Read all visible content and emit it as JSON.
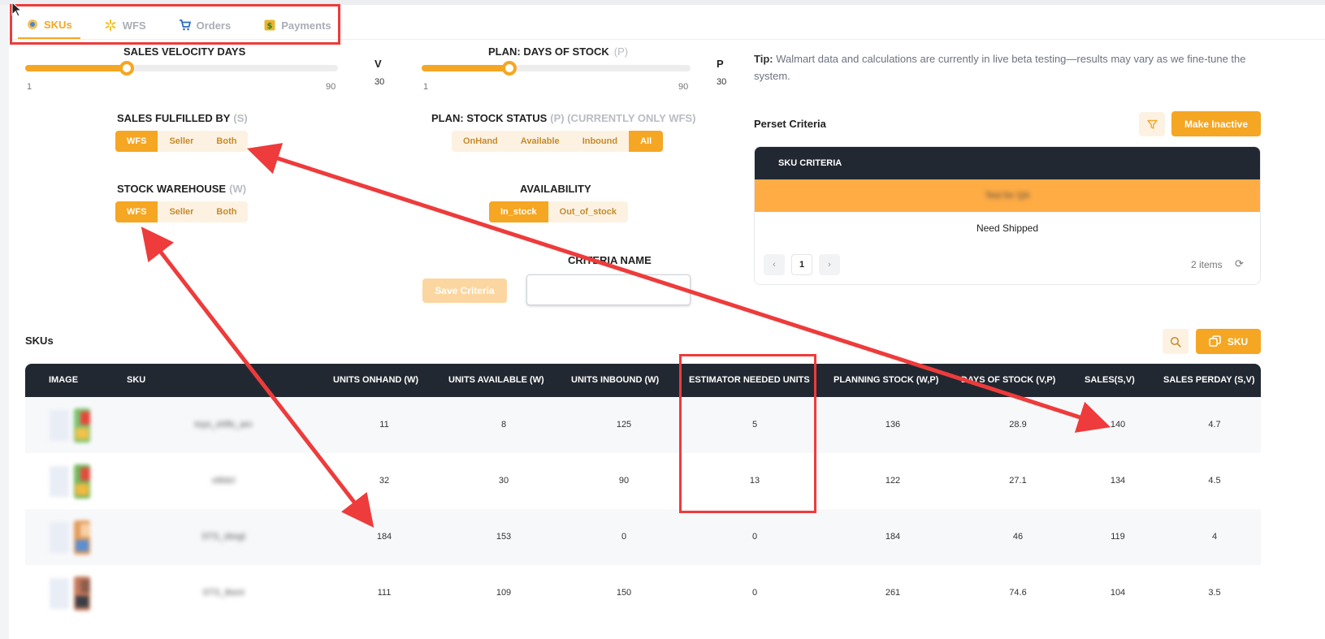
{
  "tabs": [
    {
      "label": "SKUs",
      "icon": "walmart-coin-icon",
      "active": true
    },
    {
      "label": "WFS",
      "icon": "walmart-spark-icon",
      "active": false
    },
    {
      "label": "Orders",
      "icon": "cart-icon",
      "active": false
    },
    {
      "label": "Payments",
      "icon": "dollar-icon",
      "active": false
    }
  ],
  "sales_velocity": {
    "title": "SALES VELOCITY DAYS",
    "min": "1",
    "max": "90",
    "value": 30,
    "letter": "V",
    "value_text": "30"
  },
  "plan_days": {
    "title": "PLAN: DAYS OF STOCK",
    "hint": "(P)",
    "min": "1",
    "max": "90",
    "value": 30,
    "letter": "P",
    "value_text": "30"
  },
  "fulfilled_by": {
    "title": "SALES FULFILLED BY",
    "hint": "(S)",
    "options": [
      "WFS",
      "Seller",
      "Both"
    ],
    "selected": "WFS"
  },
  "stock_status": {
    "title": "PLAN: STOCK STATUS",
    "hint": "(P) (CURRENTLY ONLY WFS)",
    "options": [
      "OnHand",
      "Available",
      "Inbound",
      "All"
    ],
    "selected": "All"
  },
  "warehouse": {
    "title": "STOCK WAREHOUSE",
    "hint": "(W)",
    "options": [
      "WFS",
      "Seller",
      "Both"
    ],
    "selected": "WFS"
  },
  "availability": {
    "title": "AVAILABILITY",
    "options": [
      "In_stock",
      "Out_of_stock"
    ],
    "selected": "In_stock"
  },
  "criteria": {
    "label": "CRITERIA NAME",
    "save_label": "Save Criteria",
    "input_value": ""
  },
  "tip": {
    "prefix": "Tip:",
    "text": "Walmart data and calculations are currently in live beta testing—results may vary as we fine-tune the system."
  },
  "perset": {
    "title": "Perset Criteria",
    "make_inactive": "Make Inactive",
    "column": "SKU CRITERIA",
    "highlight_row": "Test for QA",
    "row": "Need Shipped",
    "page": "1",
    "items": "2 items"
  },
  "skus": {
    "title": "SKUs",
    "add_label": "SKU",
    "columns": [
      "IMAGE",
      "SKU",
      "UNITS ONHAND (W)",
      "UNITS AVAILABLE (W)",
      "UNITS INBOUND (W)",
      "ESTIMATOR NEEDED UNITS",
      "PLANNING STOCK (W,P)",
      "DAYS OF STOCK (V,P)",
      "SALES(S,V)",
      "SALES PERDAY (S,V)"
    ],
    "rows": [
      {
        "sku": "toys_ohfls_am",
        "onhand": "11",
        "available": "8",
        "inbound": "125",
        "estimator": "5",
        "planning": "136",
        "days": "28.9",
        "sales": "140",
        "perday": "4.7"
      },
      {
        "sku": "xt8dcl",
        "onhand": "32",
        "available": "30",
        "inbound": "90",
        "estimator": "13",
        "planning": "122",
        "days": "27.1",
        "sales": "134",
        "perday": "4.5"
      },
      {
        "sku": "STS_sbsgt",
        "onhand": "184",
        "available": "153",
        "inbound": "0",
        "estimator": "0",
        "planning": "184",
        "days": "46",
        "sales": "119",
        "perday": "4"
      },
      {
        "sku": "STS_tbsnt",
        "onhand": "111",
        "available": "109",
        "inbound": "150",
        "estimator": "0",
        "planning": "261",
        "days": "74.6",
        "sales": "104",
        "perday": "3.5"
      }
    ]
  },
  "colors": {
    "accent": "#f5a623",
    "dark": "#222831",
    "annotation": "#ee3b3b"
  }
}
